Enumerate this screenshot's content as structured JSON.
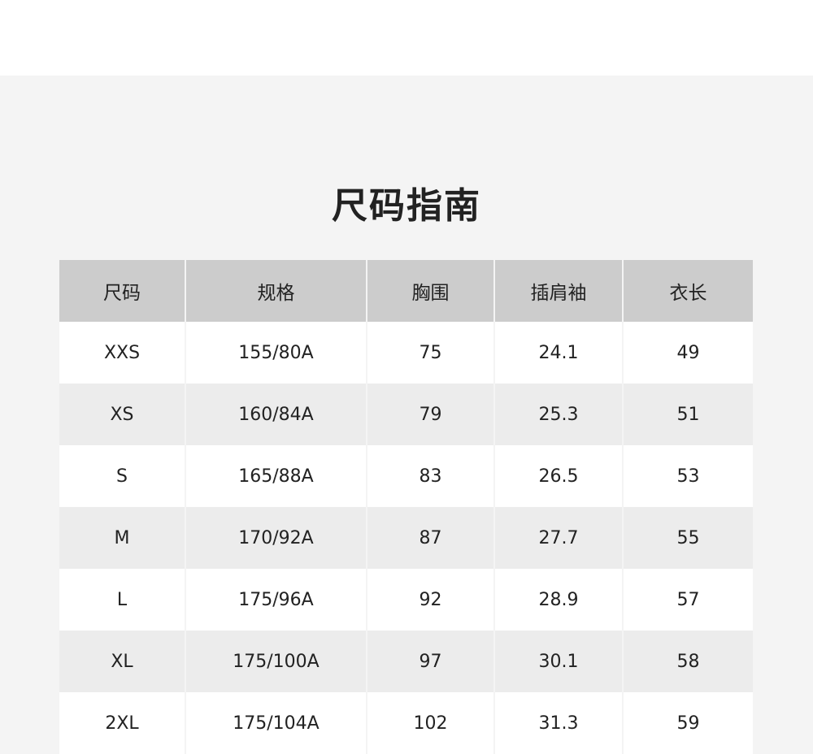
{
  "title": "尺码指南",
  "table": {
    "headers": [
      "尺码",
      "规格",
      "胸围",
      "插肩袖",
      "衣长"
    ],
    "rows": [
      [
        "XXS",
        "155/80A",
        "75",
        "24.1",
        "49"
      ],
      [
        "XS",
        "160/84A",
        "79",
        "25.3",
        "51"
      ],
      [
        "S",
        "165/88A",
        "83",
        "26.5",
        "53"
      ],
      [
        "M",
        "170/92A",
        "87",
        "27.7",
        "55"
      ],
      [
        "L",
        "175/96A",
        "92",
        "28.9",
        "57"
      ],
      [
        "XL",
        "175/100A",
        "97",
        "30.1",
        "58"
      ],
      [
        "2XL",
        "175/104A",
        "102",
        "31.3",
        "59"
      ]
    ]
  }
}
